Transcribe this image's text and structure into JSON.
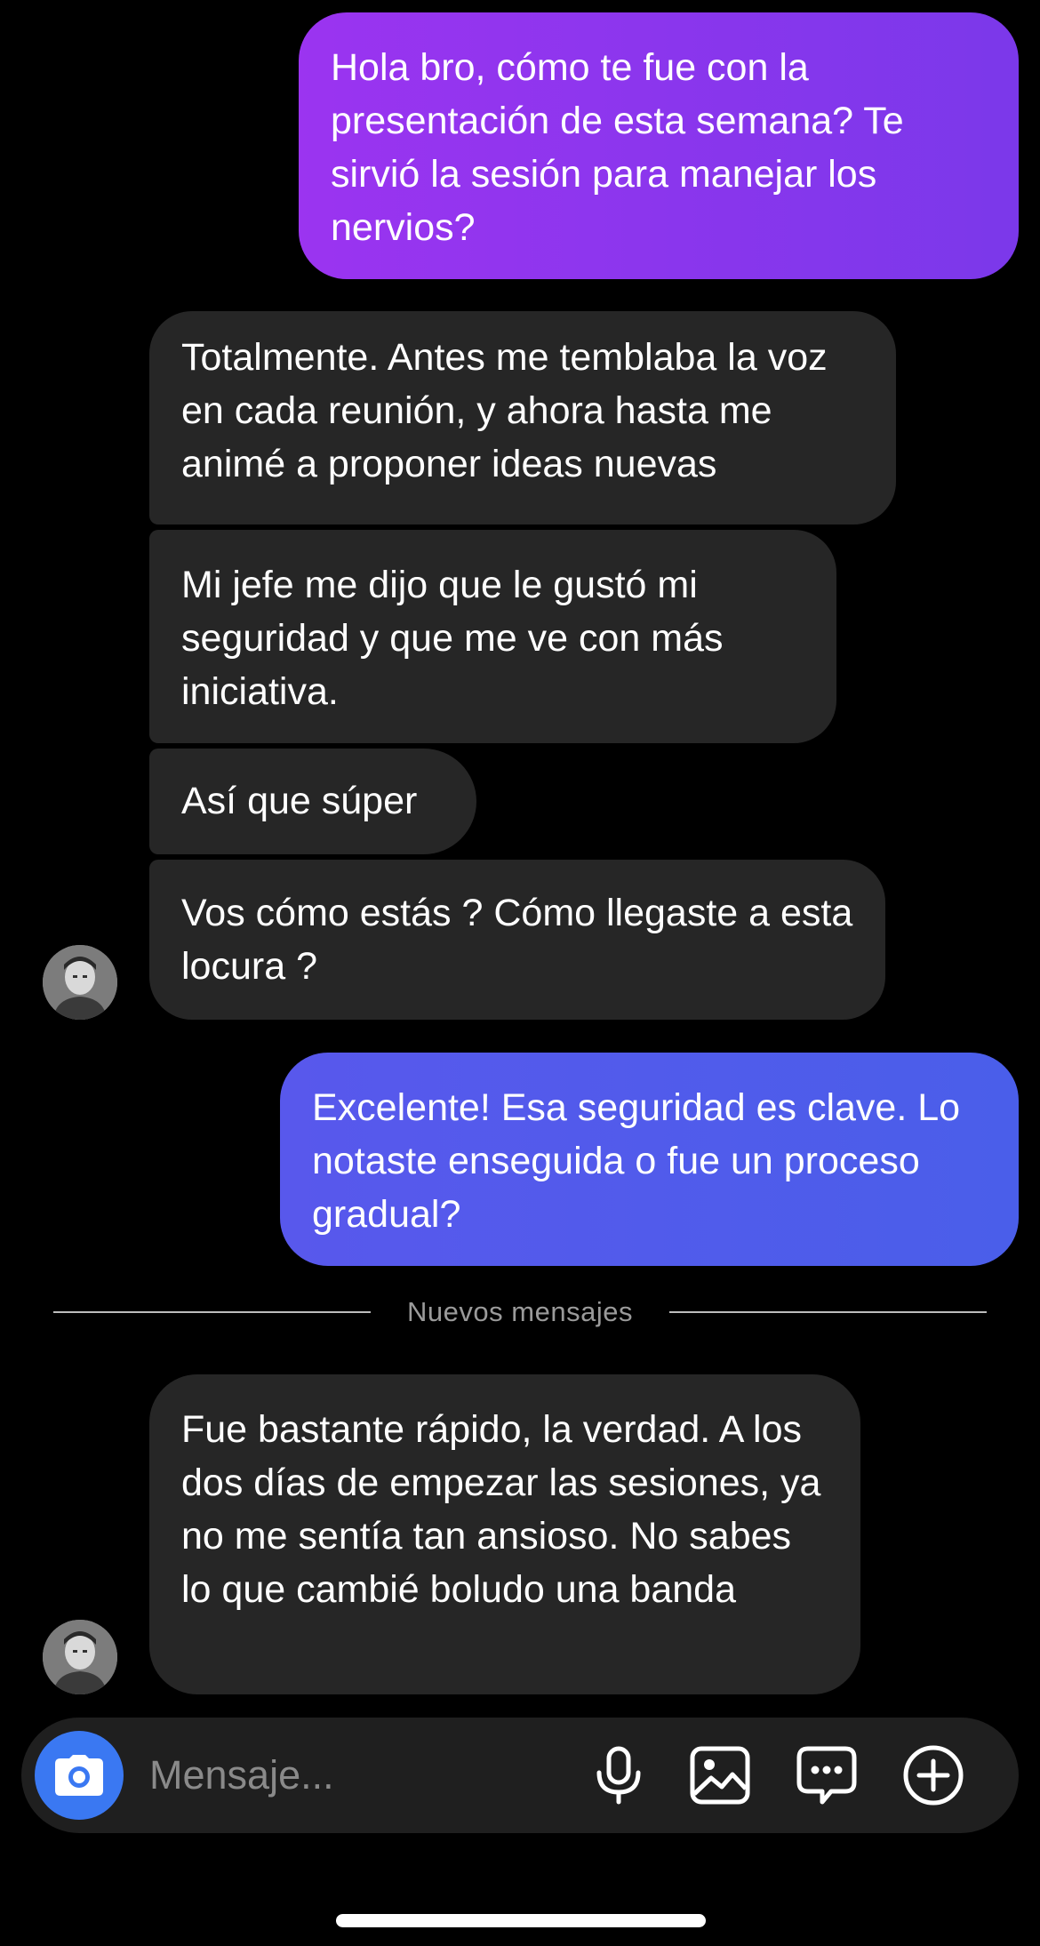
{
  "messages": [
    {
      "direction": "sent",
      "text": "Hola bro, cómo te fue con la presentación de esta semana? Te sirvió la sesión para manejar los nervios?"
    },
    {
      "direction": "received",
      "text": "Totalmente. Antes me temblaba la voz en cada reunión, y ahora hasta me animé a proponer ideas nuevas"
    },
    {
      "direction": "received",
      "text": "Mi jefe me dijo que le gustó mi seguridad y que me ve con más iniciativa."
    },
    {
      "direction": "received",
      "text": "Así que súper"
    },
    {
      "direction": "received",
      "text": "Vos cómo estás ? Cómo llegaste a esta locura ?"
    },
    {
      "direction": "sent",
      "text": "Excelente! Esa seguridad es clave. Lo notaste enseguida o fue un proceso gradual?"
    },
    {
      "direction": "received",
      "text": "Fue bastante rápido, la verdad. A los dos días de empezar las sesiones, ya no me sentía tan ansioso. No sabes lo que cambié boludo una banda"
    }
  ],
  "divider": {
    "label": "Nuevos mensajes"
  },
  "composer": {
    "placeholder": "Mensaje...",
    "icons": [
      "camera-icon",
      "microphone-icon",
      "gallery-icon",
      "sticker-chat-icon",
      "plus-icon"
    ]
  },
  "colors": {
    "background": "#000000",
    "received_bubble": "#262626",
    "sent_bubble_1": "#8a36ee",
    "sent_bubble_2": "#5060eb",
    "camera_button": "#3a78f2",
    "composer_bg": "#1f1f1f"
  }
}
